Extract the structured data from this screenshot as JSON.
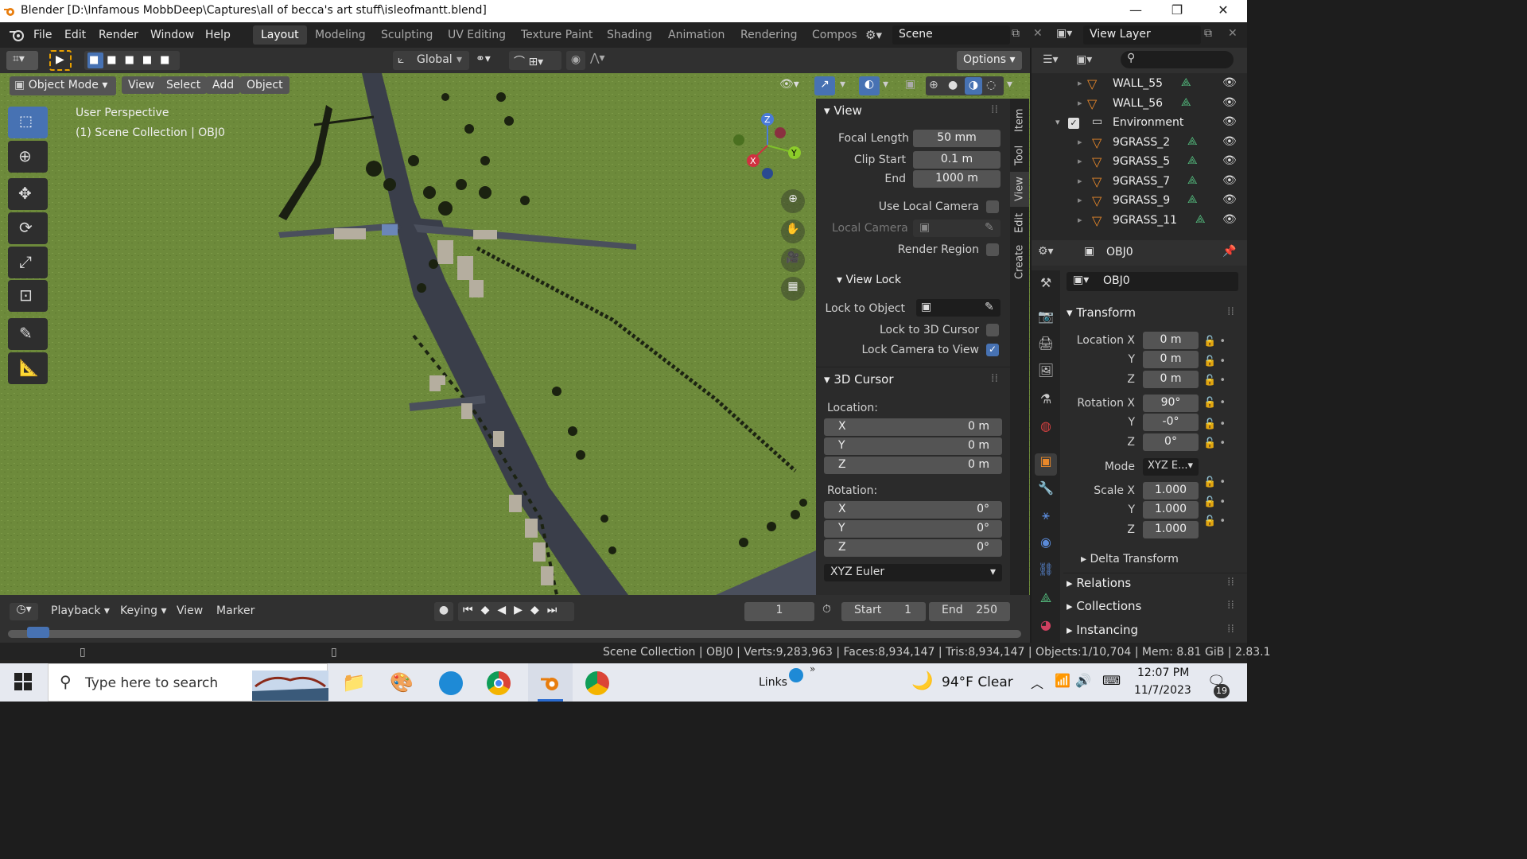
{
  "window": {
    "title": "Blender [D:\\Infamous MobbDeep\\Captures\\all of becca's art stuff\\isleofmantt.blend]",
    "minimize": "—",
    "maximize": "❐",
    "close": "✕"
  },
  "menus": [
    "File",
    "Edit",
    "Render",
    "Window",
    "Help"
  ],
  "workspaces": [
    "Layout",
    "Modeling",
    "Sculpting",
    "UV Editing",
    "Texture Paint",
    "Shading",
    "Animation",
    "Rendering",
    "Compos"
  ],
  "scene": {
    "name": "Scene",
    "view_layer": "View Layer"
  },
  "header": {
    "orientation": "Global",
    "options": "Options",
    "mode": "Object Mode",
    "view": "View",
    "select": "Select",
    "add": "Add",
    "object": "Object"
  },
  "overlay": {
    "perspective": "User Perspective",
    "collection": "(1) Scene Collection | OBJ0"
  },
  "gizmo": {
    "z": "Z",
    "y": "Y",
    "x": "X"
  },
  "npanel": {
    "tabs": [
      "Item",
      "Tool",
      "View",
      "Edit",
      "Create"
    ],
    "view_title": "View",
    "focal_length_label": "Focal Length",
    "focal_length": "50 mm",
    "clip_start_label": "Clip Start",
    "clip_start": "0.1 m",
    "end_label": "End",
    "end": "1000 m",
    "use_local_camera": "Use Local Camera",
    "local_camera": "Local Camera",
    "render_region": "Render Region",
    "view_lock_title": "View Lock",
    "lock_to_object": "Lock to Object",
    "lock_to_3d_cursor": "Lock to 3D Cursor",
    "lock_camera_to_view": "Lock Camera to View",
    "cursor_title": "3D Cursor",
    "location_label": "Location:",
    "loc": [
      {
        "axis": "X",
        "value": "0 m"
      },
      {
        "axis": "Y",
        "value": "0 m"
      },
      {
        "axis": "Z",
        "value": "0 m"
      }
    ],
    "rotation_label": "Rotation:",
    "rot": [
      {
        "axis": "X",
        "value": "0°"
      },
      {
        "axis": "Y",
        "value": "0°"
      },
      {
        "axis": "Z",
        "value": "0°"
      }
    ],
    "rot_mode": "XYZ Euler"
  },
  "outliner": {
    "rows": [
      "WALL_55",
      "WALL_56",
      "Environment",
      "9GRASS_2",
      "9GRASS_5",
      "9GRASS_7",
      "9GRASS_9",
      "9GRASS_11"
    ]
  },
  "properties": {
    "object_name": "OBJ0",
    "data_name": "OBJ0",
    "transform": "Transform",
    "location_x": "Location X",
    "loc_x": "0 m",
    "y": "Y",
    "loc_y": "0 m",
    "z": "Z",
    "loc_z": "0 m",
    "rotation_x": "Rotation X",
    "rot_x": "90°",
    "rot_y": "-0°",
    "rot_z": "0°",
    "mode_label": "Mode",
    "mode": "XYZ E...",
    "scale_x": "Scale X",
    "sc_x": "1.000",
    "sc_y": "1.000",
    "sc_z": "1.000",
    "delta": "Delta Transform",
    "relations": "Relations",
    "collections": "Collections",
    "instancing": "Instancing"
  },
  "timeline": {
    "playback": "Playback",
    "keying": "Keying",
    "view": "View",
    "marker": "Marker",
    "frame": "1",
    "start_label": "Start",
    "start": "1",
    "end_label": "End",
    "end": "250"
  },
  "status": {
    "text": "Scene Collection | OBJ0 | Verts:9,283,963 | Faces:8,934,147 | Tris:8,934,147 | Objects:1/10,704 | Mem: 8.81 GiB | 2.83.1"
  },
  "taskbar": {
    "search": "Type here to search",
    "links": "Links",
    "weather": "94°F  Clear",
    "time": "12:07 PM",
    "date": "11/7/2023",
    "notifications": "19"
  },
  "colors": {
    "accent": "#4772b3",
    "grass": "#6e8a3a",
    "road": "#3a3e4a"
  }
}
